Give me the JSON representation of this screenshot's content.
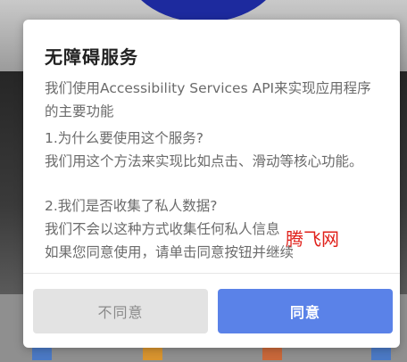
{
  "dialog": {
    "title": "无障碍服务",
    "intro": "我们使用Accessibility Services API来实现应用程序的主要功能",
    "question1": "1.为什么要使用这个服务?",
    "answer1": "我们用这个方法来实现比如点击、滑动等核心功能。",
    "question2": "2.我们是否收集了私人数据?",
    "answer2": "我们不会以这种方式收集任何私人信息",
    "answer3": "如果您同意使用，请单击同意按钮并继续",
    "disagree_label": "不同意",
    "agree_label": "同意"
  },
  "watermark": "腾飞网",
  "colors": {
    "accent": "#5a82e8",
    "disagree_bg": "#e3e3e3",
    "watermark": "#e0201a"
  }
}
